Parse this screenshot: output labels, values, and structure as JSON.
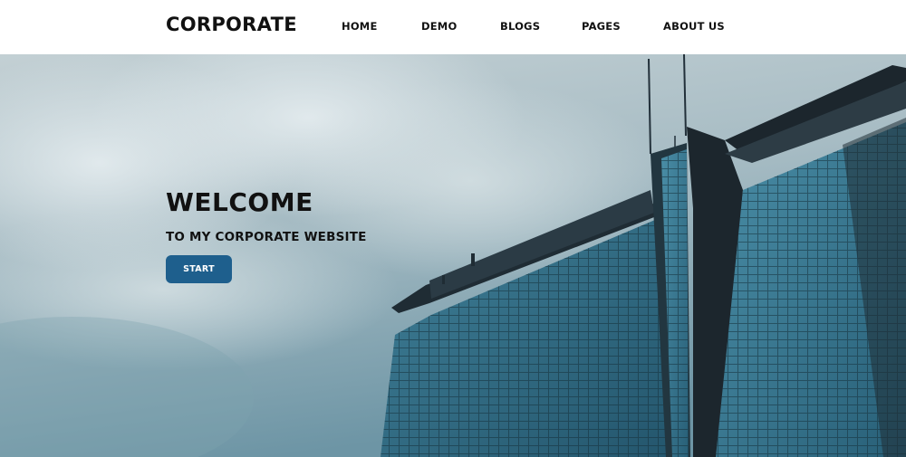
{
  "header": {
    "logo": "CORPORATE",
    "nav": [
      {
        "label": "HOME"
      },
      {
        "label": "DEMO"
      },
      {
        "label": "BLOGS"
      },
      {
        "label": "PAGES"
      },
      {
        "label": "ABOUT US"
      }
    ]
  },
  "hero": {
    "title": "WELCOME",
    "subtitle": "TO MY CORPORATE WEBSITE",
    "button_label": "START"
  },
  "colors": {
    "header_bg": "#ffffff",
    "text": "#111111",
    "accent_button": "#1e5f8d",
    "sky": "#a9bfc8",
    "glass": "#2f6c86"
  }
}
